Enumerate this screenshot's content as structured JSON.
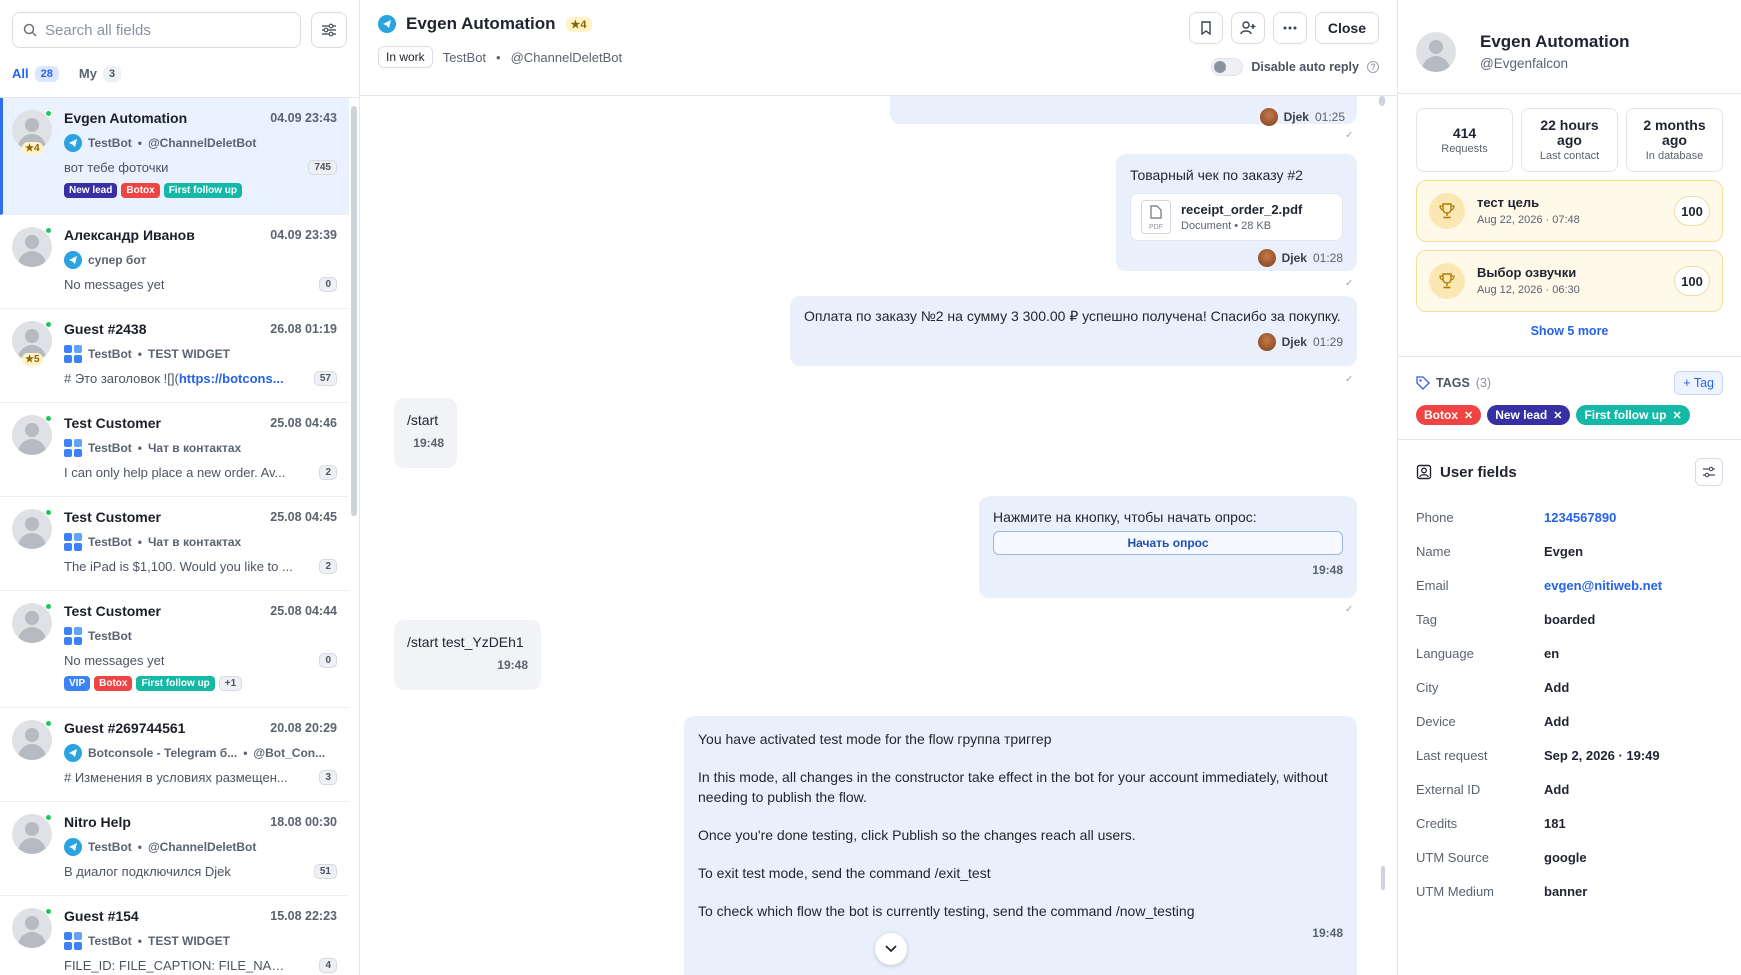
{
  "search": {
    "placeholder": "Search all fields"
  },
  "tabs": [
    {
      "label": "All",
      "count": "28"
    },
    {
      "label": "My",
      "count": "3"
    }
  ],
  "conversations": [
    {
      "name": "Evgen Automation",
      "time": "04.09 23:43",
      "bot": "TestBot",
      "channel": "@ChannelDeletBot",
      "preview": "вот тебе фоточки",
      "count": "745",
      "stars": "★4",
      "tags": [
        {
          "label": "New lead",
          "color": "#3730a3"
        },
        {
          "label": "Botox",
          "color": "#ef4444"
        },
        {
          "label": "First follow up",
          "color": "#14b8a6"
        }
      ]
    },
    {
      "name": "Александр Иванов",
      "time": "04.09 23:39",
      "bot": "супер бот",
      "channel": "",
      "preview": "No messages yet",
      "count": "0"
    },
    {
      "name": "Guest #2438",
      "time": "26.08 01:19",
      "bot": "TestBot",
      "channel": "TEST WIDGET",
      "preview": "# Это заголовок ![](",
      "preview_link": "https://botcons...",
      "count": "57",
      "stars": "★5"
    },
    {
      "name": "Test Customer",
      "time": "25.08 04:46",
      "bot": "TestBot",
      "channel": "Чат в контактах",
      "preview": "I can only help place a new order. Av...",
      "count": "2"
    },
    {
      "name": "Test Customer",
      "time": "25.08 04:45",
      "bot": "TestBot",
      "channel": "Чат в контактах",
      "preview": "The iPad is $1,100. Would you like to ...",
      "count": "2"
    },
    {
      "name": "Test Customer",
      "time": "25.08 04:44",
      "bot": "TestBot",
      "channel": "",
      "preview": "No messages yet",
      "count": "0",
      "tags": [
        {
          "label": "VIP",
          "color": "#3b82f6"
        },
        {
          "label": "Botox",
          "color": "#ef4444"
        },
        {
          "label": "First follow up",
          "color": "#14b8a6"
        }
      ],
      "more": "+1"
    },
    {
      "name": "Guest #269744561",
      "time": "20.08 20:29",
      "bot": "Botconsole - Telegram б...",
      "channel": "@Bot_Con...",
      "preview": "# Изменения в условиях размещен...",
      "count": "3"
    },
    {
      "name": "Nitro Help",
      "time": "18.08 00:30",
      "bot": "TestBot",
      "channel": "@ChannelDeletBot",
      "preview": "В диалог подключился Djek",
      "count": "51"
    },
    {
      "name": "Guest #154",
      "time": "15.08 22:23",
      "bot": "TestBot",
      "channel": "TEST WIDGET",
      "preview": "FILE_ID: FILE_CAPTION: FILE_NAME:...",
      "count": "4"
    }
  ],
  "chat": {
    "title": "Evgen Automation",
    "stars": "★4",
    "status": "In work",
    "bot": "TestBot",
    "channel": "@ChannelDeletBot",
    "close_label": "Close",
    "auto_reply": "Disable auto reply",
    "messages": {
      "m0": {
        "agent": "Djek",
        "time": "01:25"
      },
      "m1": {
        "text": "Товарный чек по заказу #2",
        "file_name": "receipt_order_2.pdf",
        "file_meta": "Document • 28 KB",
        "file_type": "PDF",
        "agent": "Djek",
        "time": "01:28"
      },
      "m2": {
        "text": "Оплата по заказу №2 на сумму 3 300.00 ₽ успешно получена! Спасибо за покупку.",
        "agent": "Djek",
        "time": "01:29"
      },
      "m3": {
        "text": "/start",
        "time": "19:48"
      },
      "m4": {
        "text": "Нажмите на кнопку, чтобы начать опрос:",
        "button": "Начать опрос",
        "time": "19:48"
      },
      "m5": {
        "text": "/start test_YzDEh1",
        "time": "19:48"
      },
      "m6": {
        "p1": "You have activated test mode for the flow группа триггер",
        "p2": "In this mode, all changes in the constructor take effect in the bot for your account immediately, without needing to publish the flow.",
        "p3": "Once you're done testing, click Publish so the changes reach all users.",
        "p4": "To exit test mode, send the command /exit_test",
        "p5": "To check which flow the bot is currently testing, send the command /now_testing",
        "time": "19:48"
      }
    }
  },
  "profile": {
    "name": "Evgen Automation",
    "handle": "@Evgenfalcon",
    "stats": [
      {
        "value": "414",
        "label": "Requests"
      },
      {
        "value": "22 hours ago",
        "label": "Last contact"
      },
      {
        "value": "2 months ago",
        "label": "In database"
      }
    ],
    "goals": [
      {
        "title": "тест цель",
        "date": "Aug 22, 2026 · 07:48",
        "score": "100"
      },
      {
        "title": "Выбор озвучки",
        "date": "Aug 12, 2026 · 06:30",
        "score": "100"
      }
    ],
    "show_more": "Show 5 more",
    "tags_label": "TAGS",
    "tags_count": "(3)",
    "add_tag": "+ Tag",
    "tags": [
      {
        "label": "Botox",
        "color": "#ef4444"
      },
      {
        "label": "New lead",
        "color": "#3730a3"
      },
      {
        "label": "First follow up",
        "color": "#14b8a6"
      }
    ],
    "user_fields_label": "User fields",
    "fields": [
      {
        "k": "Phone",
        "v": "1234567890",
        "link": true
      },
      {
        "k": "Name",
        "v": "Evgen"
      },
      {
        "k": "Email",
        "v": "evgen@nitiweb.net",
        "link": true
      },
      {
        "k": "Tag",
        "v": "boarded"
      },
      {
        "k": "Language",
        "v": "en"
      },
      {
        "k": "City",
        "v": "Add"
      },
      {
        "k": "Device",
        "v": "Add"
      },
      {
        "k": "Last request",
        "v": "Sep 2, 2026 · 19:49"
      },
      {
        "k": "External ID",
        "v": "Add"
      },
      {
        "k": "Credits",
        "v": "181"
      },
      {
        "k": "UTM Source",
        "v": "google"
      },
      {
        "k": "UTM Medium",
        "v": "banner"
      }
    ]
  }
}
